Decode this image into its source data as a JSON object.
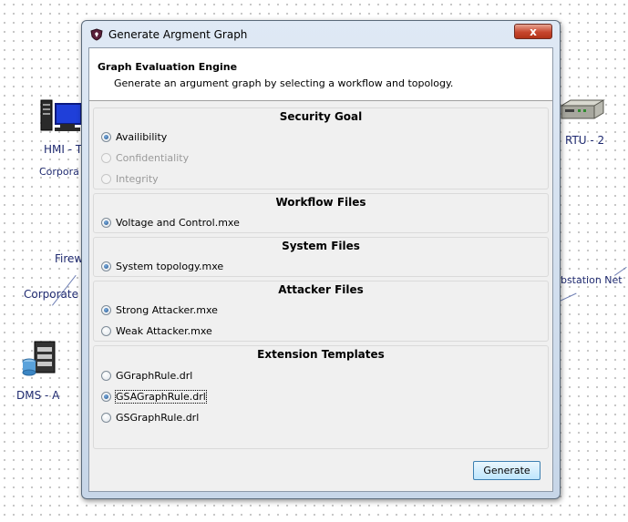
{
  "background": {
    "labels": {
      "hmi": "HMI - T",
      "corporate_top": "Corpora",
      "firewall": "Firew",
      "corporate_left": "Corporate",
      "dms": "DMS - A",
      "rtu": "RTU - 2",
      "substation": "ubstation Net"
    },
    "icons": [
      "computer-monitor-icon",
      "server-database-icon",
      "rtu-device-icon"
    ]
  },
  "dialog": {
    "title": "Generate Argment Graph",
    "close_label": "x",
    "header": {
      "title": "Graph Evaluation Engine",
      "description": "Generate an argument graph by selecting a workflow and topology."
    },
    "groups": {
      "security_goal": {
        "title": "Security Goal",
        "options": [
          {
            "label": "Availibility",
            "checked": true,
            "enabled": true
          },
          {
            "label": "Confidentiality",
            "checked": false,
            "enabled": false
          },
          {
            "label": "Integrity",
            "checked": false,
            "enabled": false
          }
        ]
      },
      "workflow_files": {
        "title": "Workflow Files",
        "options": [
          {
            "label": "Voltage and Control.mxe",
            "checked": true,
            "enabled": true
          }
        ]
      },
      "system_files": {
        "title": "System Files",
        "options": [
          {
            "label": "System topology.mxe",
            "checked": true,
            "enabled": true
          }
        ]
      },
      "attacker_files": {
        "title": "Attacker Files",
        "options": [
          {
            "label": "Strong Attacker.mxe",
            "checked": true,
            "enabled": true
          },
          {
            "label": "Weak Attacker.mxe",
            "checked": false,
            "enabled": true
          }
        ]
      },
      "extension_templates": {
        "title": "Extension Templates",
        "options": [
          {
            "label": "GGraphRule.drl",
            "checked": false,
            "enabled": true
          },
          {
            "label": "GSAGraphRule.drl",
            "checked": true,
            "enabled": true,
            "focused": true
          },
          {
            "label": "GSGraphRule.drl",
            "checked": false,
            "enabled": true
          }
        ]
      }
    },
    "generate_label": "Generate"
  }
}
